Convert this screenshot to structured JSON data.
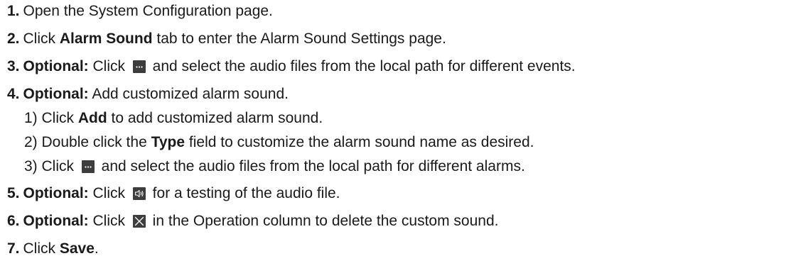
{
  "steps": [
    {
      "num": "1.",
      "text": "Open the System Configuration page."
    },
    {
      "num": "2.",
      "pre": "Click ",
      "bold": "Alarm Sound",
      "post": " tab to enter the Alarm Sound Settings page."
    },
    {
      "num": "3.",
      "label": "Optional:",
      "pre": " Click ",
      "post": " and select the audio files from the local path for different events."
    },
    {
      "num": "4.",
      "label": "Optional:",
      "text": " Add customized alarm sound.",
      "substeps": [
        {
          "pre": "1) Click ",
          "bold": "Add",
          "post": " to add customized alarm sound."
        },
        {
          "pre": "2) Double click the ",
          "bold": "Type",
          "post": " field to customize the alarm sound name as desired."
        },
        {
          "pre": "3) Click ",
          "post": " and select the audio files from the local path for different alarms."
        }
      ]
    },
    {
      "num": "5.",
      "label": "Optional:",
      "pre": " Click ",
      "post": " for a testing of the audio file."
    },
    {
      "num": "6.",
      "label": "Optional:",
      "pre": " Click ",
      "post": " in the Operation column to delete the custom sound."
    },
    {
      "num": "7.",
      "pre": "Click ",
      "bold": "Save",
      "post": "."
    }
  ],
  "icons": {
    "browse": "ellipsis-browse-icon",
    "sound": "speaker-test-icon",
    "delete": "close-delete-icon"
  }
}
